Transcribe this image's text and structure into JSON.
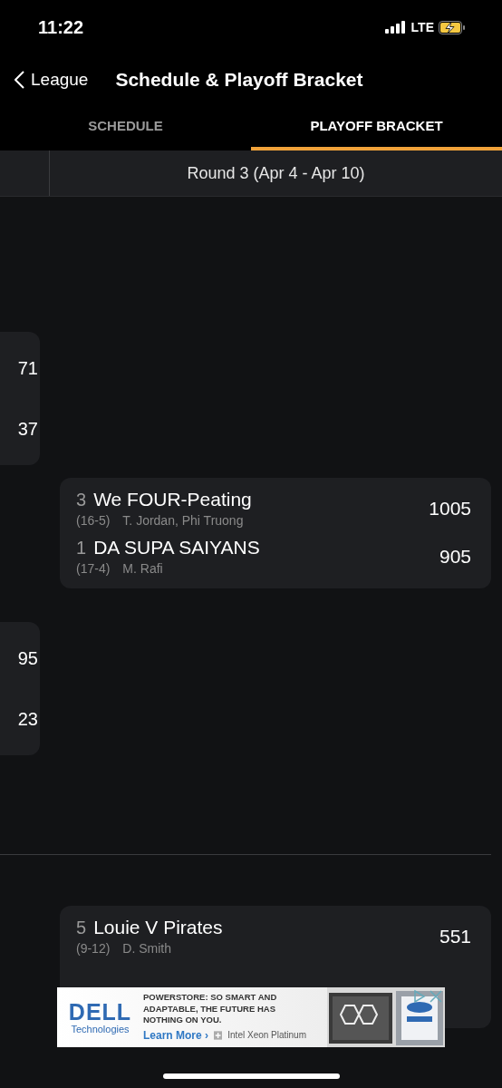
{
  "status_bar": {
    "time": "11:22",
    "network": "LTE"
  },
  "nav": {
    "back_label": "League",
    "title": "Schedule & Playoff Bracket"
  },
  "tabs": [
    {
      "label": "SCHEDULE",
      "selected": false
    },
    {
      "label": "PLAYOFF BRACKET",
      "selected": true
    }
  ],
  "round_header": {
    "title": "Round 3 (Apr 4 - Apr 10)"
  },
  "previous_round": [
    {
      "scores": [
        "71",
        "37"
      ]
    },
    {
      "scores": [
        "95",
        "23"
      ]
    }
  ],
  "sections": [
    {
      "matchups": [
        {
          "teams": [
            {
              "seed": "3",
              "name": "We FOUR-Peating",
              "record": "(16-5)",
              "managers": "T. Jordan, Phi Truong",
              "score": "1005"
            },
            {
              "seed": "1",
              "name": "DA SUPA SAIYANS",
              "record": "(17-4)",
              "managers": "M. Rafi",
              "score": "905"
            }
          ]
        }
      ]
    },
    {
      "matchups": [
        {
          "teams": [
            {
              "seed": "5",
              "name": "Louie V Pirates",
              "record": "(9-12)",
              "managers": "D. Smith",
              "score": "551"
            }
          ]
        }
      ]
    }
  ],
  "ad": {
    "brand": "DELL",
    "brand_sub": "Technologies",
    "headline": "POWERSTORE: SO SMART AND ADAPTABLE, THE FUTURE HAS NOTHING ON YOU.",
    "cta": "Learn More ›",
    "caption": "Intel Xeon Platinum"
  }
}
